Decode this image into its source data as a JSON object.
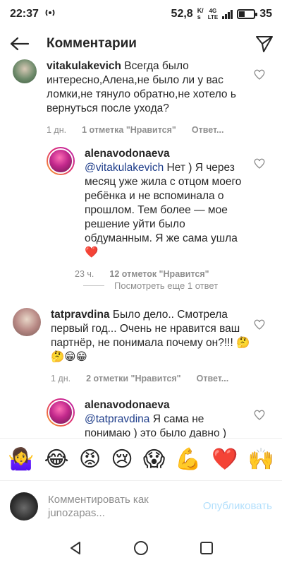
{
  "status_bar": {
    "time": "22:37",
    "net_speed": "52,8",
    "net_unit_top": "K/",
    "net_unit_bottom": "s",
    "network_top": "4G",
    "network_bottom": "LTE",
    "battery": "35",
    "battery_level": 0.35
  },
  "header": {
    "title": "Комментарии",
    "back_icon": "arrow-left-icon",
    "share_icon": "paper-plane-icon"
  },
  "comments": [
    {
      "username": "vitakulakevich",
      "text": " Всегда было интересно,Алена,не было ли у вас ломки,не  тянуло обратно,не хотело ь вернуться  после ухода?",
      "time": "1 дн.",
      "likes": "1 отметка \"Нравится\"",
      "reply": "Ответ..."
    },
    {
      "username": "alenavodonaeva",
      "mention": "@vitakulakevich",
      "text": " Нет ) Я через месяц уже жила с отцом моего ребёнка и не вспоминала о прошлом. Тем более — мое решение уйти было обдуманным. Я же сама ушла ❤️",
      "time": "23 ч.",
      "likes": "12 отметок \"Нравится\""
    },
    {
      "more_replies": "Посмотреть еще 1 ответ"
    },
    {
      "username": "tatpravdina",
      "text": " Было дело.. Смотрела первый год... Очень не нравится ваш партнёр, не понимала почему он?!!! 🤔🤔😁😁",
      "time": "1 дн.",
      "likes": "2 отметки \"Нравится\"",
      "reply": "Ответ..."
    },
    {
      "username": "alenavodonaeva",
      "mention": "@tatpravdina",
      "text": " Я сама не понимаю ) это было давно )"
    }
  ],
  "emoji_bar": [
    "🤷‍♀️",
    "😂",
    "😡",
    "😢",
    "😱",
    "💪",
    "❤️",
    "🙌"
  ],
  "input": {
    "placeholder": "Комментировать как junozapas...",
    "publish_label": "Опубликовать"
  },
  "nav": {
    "back_icon": "triangle-back-icon",
    "home_icon": "circle-home-icon",
    "recents_icon": "square-recents-icon"
  },
  "colors": {
    "mention": "#1e3d8a",
    "publish_disabled": "#b2dffc",
    "meta_gray": "#8e8e8e"
  }
}
